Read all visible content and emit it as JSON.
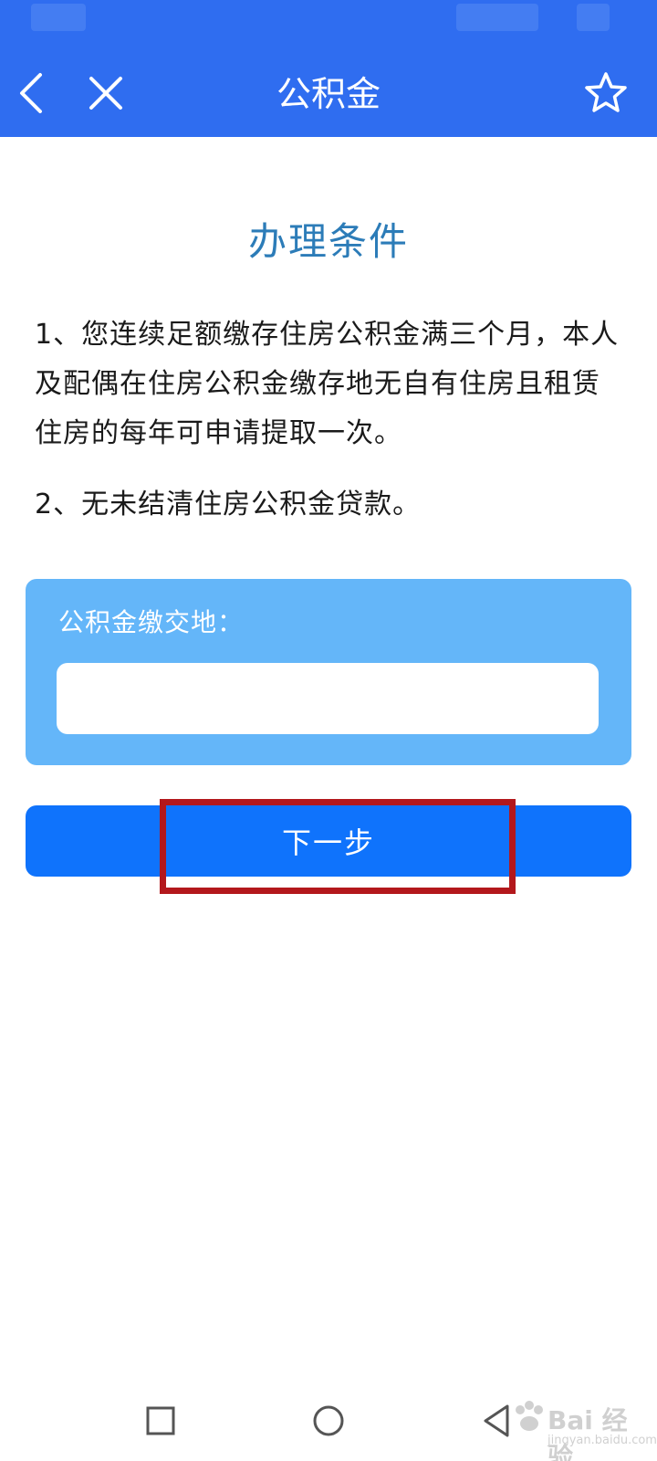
{
  "header": {
    "title": "公积金",
    "back_icon": "chevron-left-icon",
    "close_icon": "close-icon",
    "favorite_icon": "star-outline-icon",
    "background_color": "#2f6df0"
  },
  "content": {
    "section_title": "办理条件",
    "conditions": [
      "1、您连续足额缴存住房公积金满三个月，本人及配偶在住房公积金缴存地无自有住房且租赁住房的每年可申请提取一次。",
      "2、无未结清住房公积金贷款。"
    ],
    "title_color": "#2c7cb8"
  },
  "form": {
    "region_label": "公积金缴交地：",
    "region_value": "",
    "card_color": "#64b6f9"
  },
  "actions": {
    "next_label": "下一步",
    "button_color": "#0f73fc",
    "highlight_color": "#b3181c"
  },
  "system_nav": {
    "recent_icon": "square-icon",
    "home_icon": "circle-icon",
    "back_icon": "triangle-back-icon"
  },
  "watermark": {
    "brand": "Bai 经验",
    "url": "jingyan.baidu.com"
  }
}
